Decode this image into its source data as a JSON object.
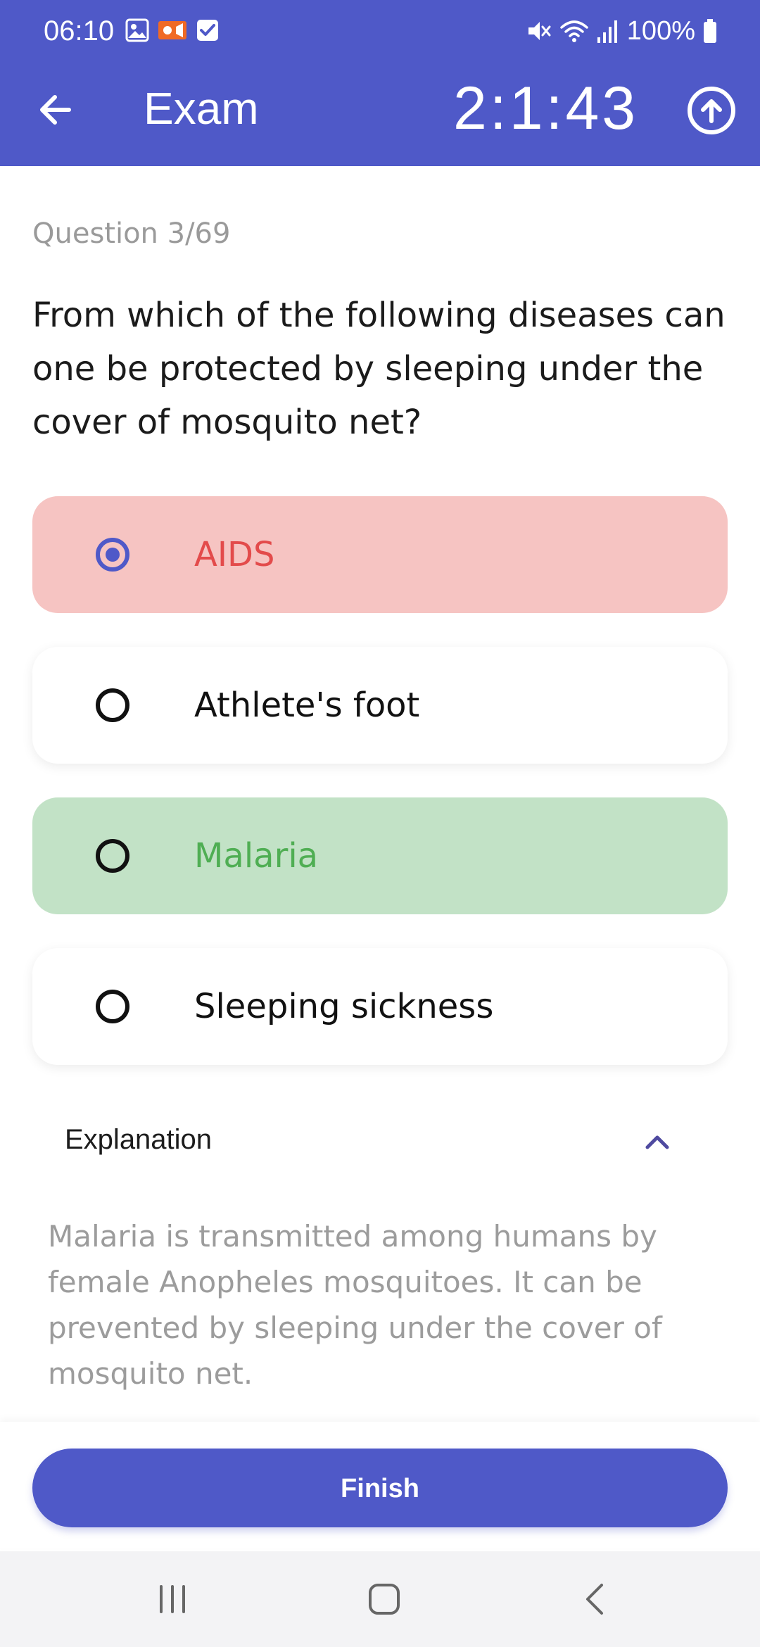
{
  "status_bar": {
    "time": "06:10",
    "battery": "100%",
    "icons": [
      "gallery-icon",
      "video-record-icon",
      "check-icon",
      "mute-icon",
      "wifi-icon",
      "signal-icon",
      "battery-icon"
    ]
  },
  "header": {
    "title": "Exam",
    "timer": "2:1:43"
  },
  "question": {
    "counter": "Question 3/69",
    "text": "From which of the following diseases can one be protected by sleeping under the cover of mosquito net?"
  },
  "options": [
    {
      "label": "AIDS",
      "state": "selected-incorrect",
      "bg": "#f6c4c2",
      "text_color": "#e34b4b",
      "selected": true
    },
    {
      "label": "Athlete's foot",
      "state": "default",
      "bg": "#ffffff",
      "text_color": "#111111",
      "selected": false
    },
    {
      "label": "Malaria",
      "state": "correct",
      "bg": "#c2e2c6",
      "text_color": "#4fae53",
      "selected": false
    },
    {
      "label": "Sleeping sickness",
      "state": "default",
      "bg": "#ffffff",
      "text_color": "#111111",
      "selected": false
    }
  ],
  "explanation": {
    "title": "Explanation",
    "text": "Malaria is transmitted among humans by female Anopheles mosquitoes. It can be prevented by sleeping under the cover of mosquito net.",
    "expanded": true
  },
  "actions": {
    "finish_label": "Finish"
  },
  "colors": {
    "primary": "#4f59c8",
    "incorrect_bg": "#f6c4c2",
    "incorrect_text": "#e34b4b",
    "correct_bg": "#c2e2c6",
    "correct_text": "#4fae53"
  }
}
